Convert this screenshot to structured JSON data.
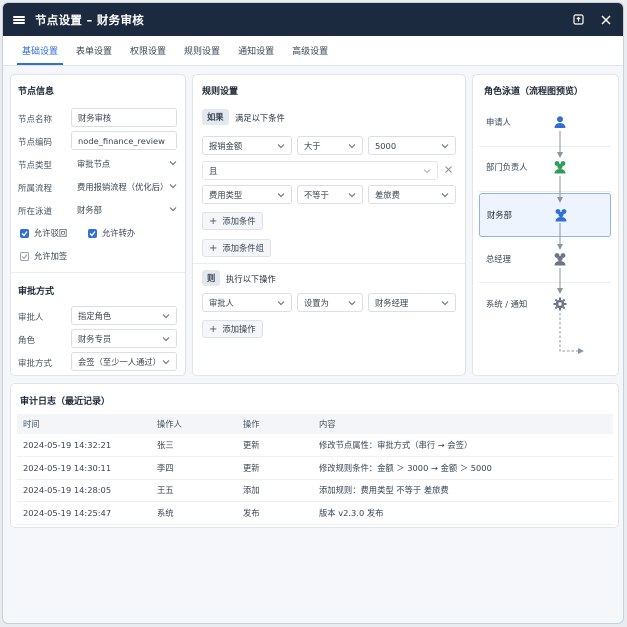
{
  "window": {
    "title": "节点设置 – 财务审核"
  },
  "tabs": [
    {
      "label": "基础设置",
      "active": true
    },
    {
      "label": "表单设置"
    },
    {
      "label": "权限设置"
    },
    {
      "label": "规则设置"
    },
    {
      "label": "通知设置"
    },
    {
      "label": "高级设置"
    }
  ],
  "node_info": {
    "title": "节点信息",
    "name_label": "节点名称",
    "name_value": "财务审核",
    "code_label": "节点编码",
    "code_value": "node_finance_review",
    "type_label": "节点类型",
    "type_value": "审批节点",
    "flow_label": "所属流程",
    "flow_value": "费用报销流程（优化后）",
    "lane_label": "所在泳道",
    "lane_value": "财务部",
    "allow_reject": "允许驳回",
    "allow_transfer": "允许转办",
    "allow_addsign": "允许加签",
    "allow_reject_checked": true,
    "allow_transfer_checked": true,
    "allow_addsign_checked": false
  },
  "approval": {
    "title": "审批方式",
    "approver_label": "审批人",
    "approver_value": "指定角色",
    "role_label": "角色",
    "role_value": "财务专员",
    "mode_label": "审批方式",
    "mode_value": "会签（至少一人通过）"
  },
  "rules": {
    "title": "规则设置",
    "if_tag": "如果",
    "if_text": "满足以下条件",
    "cond1": {
      "field": "报销金额",
      "op": "大于",
      "value": "5000"
    },
    "and_tag": "且",
    "cond2": {
      "field": "费用类型",
      "op": "不等于",
      "value": "差旅费"
    },
    "add_condition": "添加条件",
    "add_group": "添加条件组",
    "then_tag": "则",
    "then_text": "执行以下操作",
    "action1": {
      "field": "审批人",
      "op": "设置为",
      "value": "财务经理"
    },
    "add_action": "添加操作"
  },
  "lanes": {
    "title": "角色泳道（流程图预览）",
    "items": [
      {
        "label": "申请人",
        "icon": "user-icon",
        "color": "#2f6fd6"
      },
      {
        "label": "部门负责人",
        "icon": "users-icon",
        "color": "#2e9d5b"
      },
      {
        "label": "财务部",
        "icon": "users-icon",
        "color": "#2f6fd6",
        "active": true
      },
      {
        "label": "总经理",
        "icon": "users-icon",
        "color": "#6b7785"
      },
      {
        "label": "系统 / 通知",
        "icon": "gear-icon",
        "color": "#6b7785"
      }
    ]
  },
  "audit": {
    "title": "审计日志（最近记录）",
    "columns": [
      "时间",
      "操作人",
      "操作",
      "内容"
    ],
    "rows": [
      [
        "2024-05-19 14:32:21",
        "张三",
        "更新",
        "修改节点属性：审批方式（串行 → 会签）"
      ],
      [
        "2024-05-19 14:30:11",
        "李四",
        "更新",
        "修改规则条件：金额 ＞ 3000 → 金额 ＞ 5000"
      ],
      [
        "2024-05-19 14:28:05",
        "王五",
        "添加",
        "添加规则：费用类型 不等于 差旅费"
      ],
      [
        "2024-05-19 14:25:47",
        "系统",
        "发布",
        "版本 v2.3.0 发布"
      ]
    ]
  },
  "colors": {
    "accent": "#2f6fd6",
    "titlebar": "#1c2a3f",
    "green": "#2e9d5b"
  }
}
